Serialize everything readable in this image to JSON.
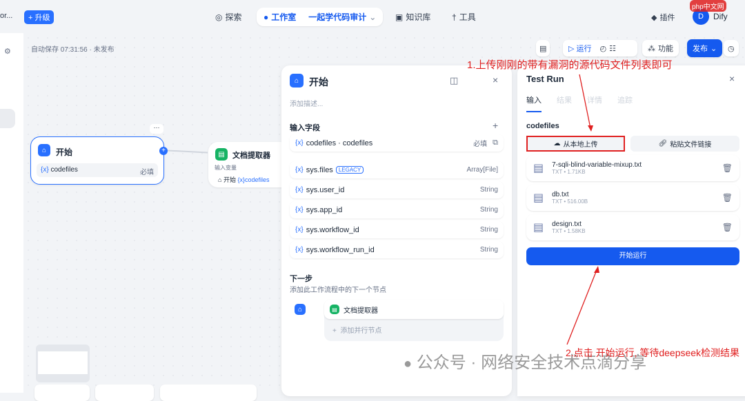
{
  "header": {
    "workspace": "or...",
    "upgrade": "升级",
    "nav": [
      {
        "label": "探索"
      },
      {
        "label": "工作室"
      },
      {
        "label": "知识库"
      },
      {
        "label": "工具"
      }
    ],
    "app_name": "一起学代码审计",
    "plugins": "插件",
    "user_initial": "D",
    "user_name": "Dify",
    "watermark_logo": "php中文网"
  },
  "toolbar": {
    "autosave": "自动保存 07:31:56 · 未发布",
    "run": "运行",
    "features": "功能",
    "publish": "发布"
  },
  "canvas": {
    "start_node": {
      "title": "开始",
      "var": "codefiles",
      "required": "必填"
    },
    "extractor_node": {
      "title": "文档提取器",
      "input_label": "输入变量",
      "src": "开始",
      "var": "codefiles"
    }
  },
  "start_panel": {
    "title": "开始",
    "desc_placeholder": "添加描述...",
    "fields_title": "输入字段",
    "fields": [
      {
        "name": "codefiles · codefiles",
        "type": "必填"
      }
    ],
    "sys_vars": [
      {
        "name": "sys.files",
        "badge": "LEGACY",
        "type": "Array[File]"
      },
      {
        "name": "sys.user_id",
        "type": "String"
      },
      {
        "name": "sys.app_id",
        "type": "String"
      },
      {
        "name": "sys.workflow_id",
        "type": "String"
      },
      {
        "name": "sys.workflow_run_id",
        "type": "String"
      }
    ],
    "next_title": "下一步",
    "next_desc": "添加此工作流程中的下一个节点",
    "next_node": "文档提取器",
    "add_parallel": "添加并行节点"
  },
  "test_run": {
    "title": "Test Run",
    "tabs": [
      "输入",
      "结果",
      "详情",
      "追踪"
    ],
    "field": "codefiles",
    "upload_local": "从本地上传",
    "paste_link": "粘贴文件链接",
    "files": [
      {
        "name": "7-sqli-blind-variable-mixup.txt",
        "meta": "TXT • 1.71KB"
      },
      {
        "name": "db.txt",
        "meta": "TXT • 516.00B"
      },
      {
        "name": "design.txt",
        "meta": "TXT • 1.58KB"
      }
    ],
    "start": "开始运行"
  },
  "annotations": {
    "a1": "1.上传刚刚的带有漏洞的源代码文件列表即可",
    "a2": "2.点击 开始运行, 等待deepseek检测结果"
  },
  "watermark": "公众号 · 网络安全技术点滴分享"
}
